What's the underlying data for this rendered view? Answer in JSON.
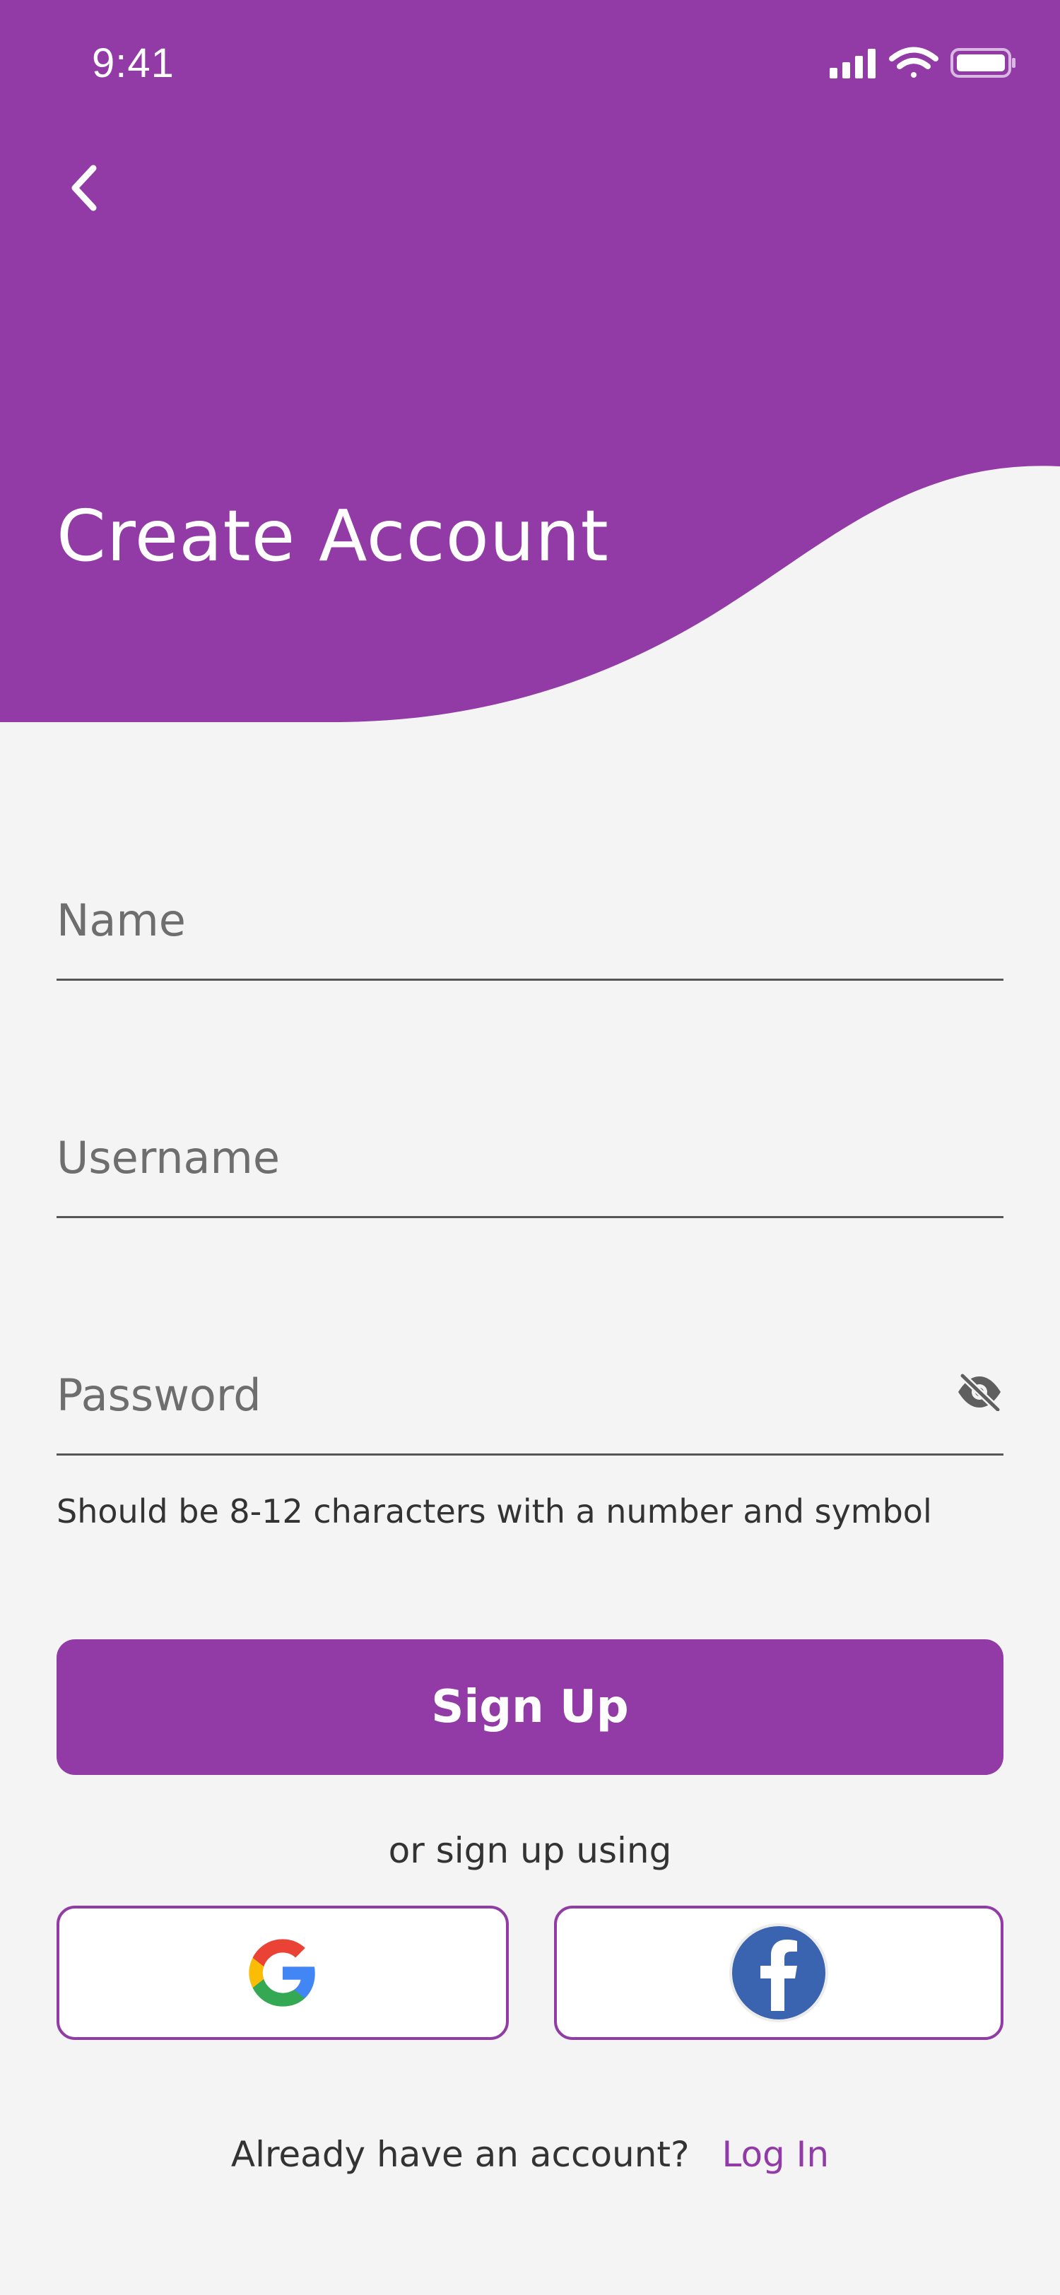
{
  "status_bar": {
    "time": "9:41"
  },
  "header": {
    "title": "Create Account"
  },
  "form": {
    "name": {
      "placeholder": "Name",
      "value": ""
    },
    "username": {
      "placeholder": "Username",
      "value": ""
    },
    "password": {
      "placeholder": "Password",
      "value": ""
    },
    "password_hint": "Should be 8-12 characters with a number and symbol"
  },
  "actions": {
    "signup_label": "Sign Up",
    "alt_signup_text": "or sign up using"
  },
  "footer": {
    "prompt": "Already have an account?",
    "login_label": "Log In"
  },
  "colors": {
    "brand": "#923ba6",
    "background": "#f4f4f4",
    "facebook": "#3b64b0"
  },
  "icons": [
    "back-arrow-icon",
    "signal-icon",
    "wifi-icon",
    "battery-icon",
    "eye-off-icon",
    "google-icon",
    "facebook-icon"
  ]
}
